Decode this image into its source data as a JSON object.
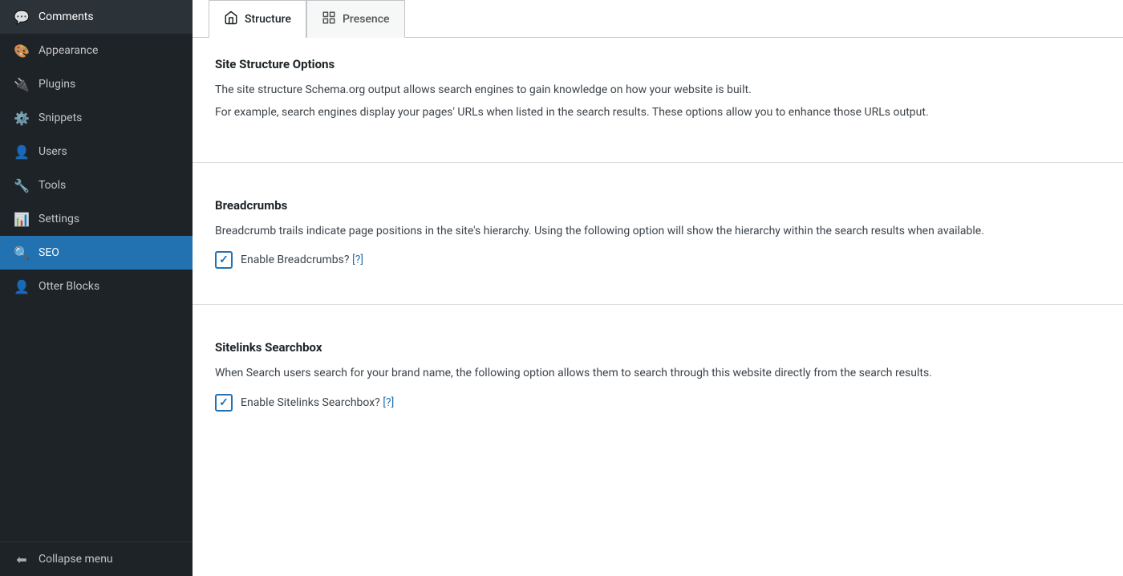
{
  "sidebar": {
    "items": [
      {
        "id": "comments",
        "label": "Comments",
        "icon": "💬",
        "active": false
      },
      {
        "id": "appearance",
        "label": "Appearance",
        "icon": "🎨",
        "active": false
      },
      {
        "id": "plugins",
        "label": "Plugins",
        "icon": "🔌",
        "active": false
      },
      {
        "id": "snippets",
        "label": "Snippets",
        "icon": "⚙️",
        "active": false
      },
      {
        "id": "users",
        "label": "Users",
        "icon": "👤",
        "active": false
      },
      {
        "id": "tools",
        "label": "Tools",
        "icon": "🔧",
        "active": false
      },
      {
        "id": "settings",
        "label": "Settings",
        "icon": "📊",
        "active": false
      },
      {
        "id": "seo",
        "label": "SEO",
        "icon": "🔍",
        "active": true
      },
      {
        "id": "otter-blocks",
        "label": "Otter Blocks",
        "icon": "👤",
        "active": false
      }
    ],
    "collapse_label": "Collapse menu",
    "collapse_icon": "⬅"
  },
  "tabs": [
    {
      "id": "structure",
      "label": "Structure",
      "icon": "🏠",
      "active": true
    },
    {
      "id": "presence",
      "label": "Presence",
      "icon": "📊",
      "active": false
    }
  ],
  "sections": {
    "site_structure": {
      "title": "Site Structure Options",
      "desc1": "The site structure Schema.org output allows search engines to gain knowledge on how your website is built.",
      "desc2": "For example, search engines display your pages' URLs when listed in the search results. These options allow you to enhance those URLs output."
    },
    "breadcrumbs": {
      "title": "Breadcrumbs",
      "desc": "Breadcrumb trails indicate page positions in the site's hierarchy. Using the following option will show the hierarchy within the search results when available.",
      "checkbox_label": "Enable Breadcrumbs?",
      "help_text": "[?]",
      "checked": true
    },
    "sitelinks_searchbox": {
      "title": "Sitelinks Searchbox",
      "desc": "When Search users search for your brand name, the following option allows them to search through this website directly from the search results.",
      "checkbox_label": "Enable Sitelinks Searchbox?",
      "help_text": "[?]",
      "checked": true
    }
  }
}
